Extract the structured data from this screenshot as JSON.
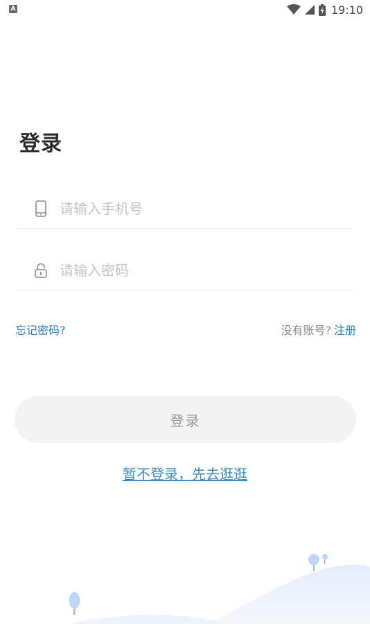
{
  "status_bar": {
    "app_badge": "A",
    "time": "19:10"
  },
  "login": {
    "title": "登录",
    "phone_placeholder": "请输入手机号",
    "password_placeholder": "请输入密码",
    "forgot_password": "忘记密码?",
    "no_account": "没有账号?",
    "register": "注册",
    "login_button": "登录",
    "guest_link": "暂不登录，先去逛逛"
  },
  "colors": {
    "accent": "#2a7fc0",
    "button_bg": "#f3f3f3",
    "title": "#2b2b2b",
    "placeholder": "#c4c4c4"
  }
}
